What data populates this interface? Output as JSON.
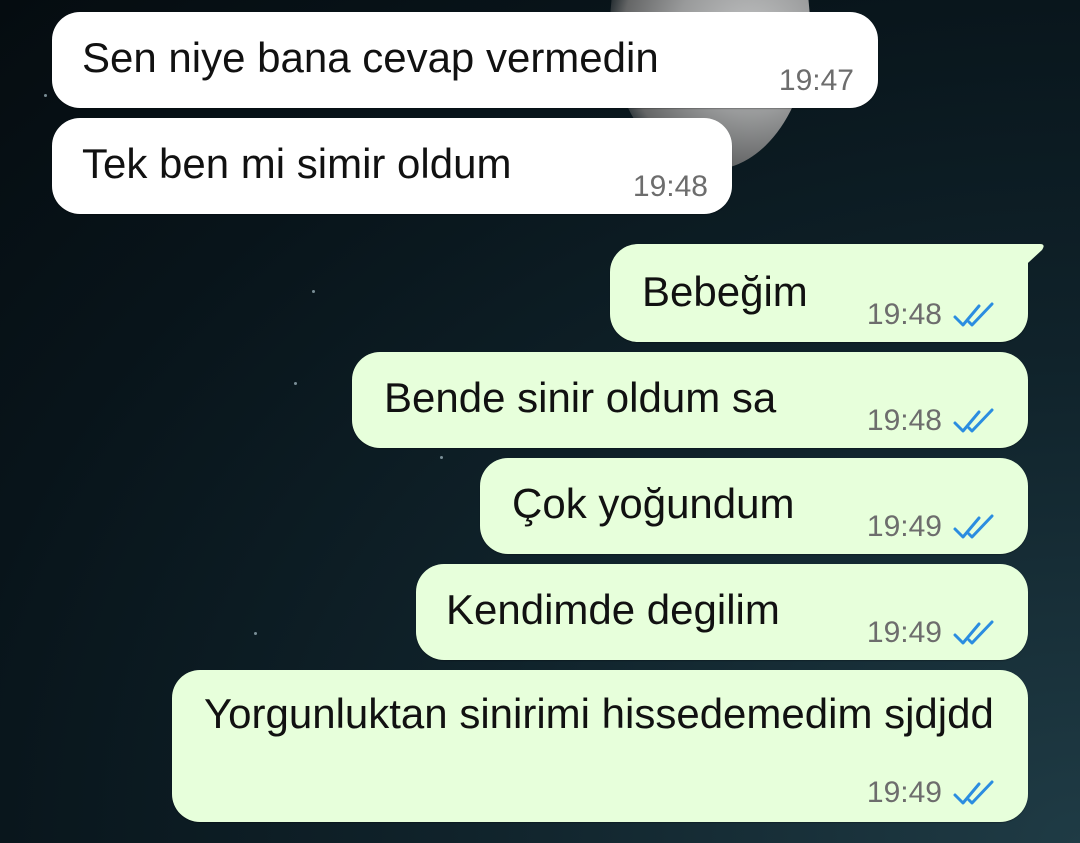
{
  "chat": {
    "messages": [
      {
        "direction": "in",
        "text": "Sen niye bana cevap vermedin",
        "time": "19:47"
      },
      {
        "direction": "in",
        "text": "Tek ben mi simir oldum",
        "time": "19:48"
      },
      {
        "direction": "out",
        "text": "Bebeğim",
        "time": "19:48",
        "status": "read"
      },
      {
        "direction": "out",
        "text": "Bende sinir oldum sa",
        "time": "19:48",
        "status": "read"
      },
      {
        "direction": "out",
        "text": "Çok yoğundum",
        "time": "19:49",
        "status": "read"
      },
      {
        "direction": "out",
        "text": "Kendimde degilim",
        "time": "19:49",
        "status": "read"
      },
      {
        "direction": "out",
        "text": "Yorgunluktan sinirimi hissedemedim sjdjdd",
        "time": "19:49",
        "status": "read"
      }
    ]
  },
  "colors": {
    "incoming_bubble": "#ffffff",
    "outgoing_bubble": "#e7ffdb",
    "read_ticks": "#2b8de0",
    "timestamp": "#6d6d6d"
  },
  "icons": {
    "read_receipt": "double-check-icon"
  }
}
